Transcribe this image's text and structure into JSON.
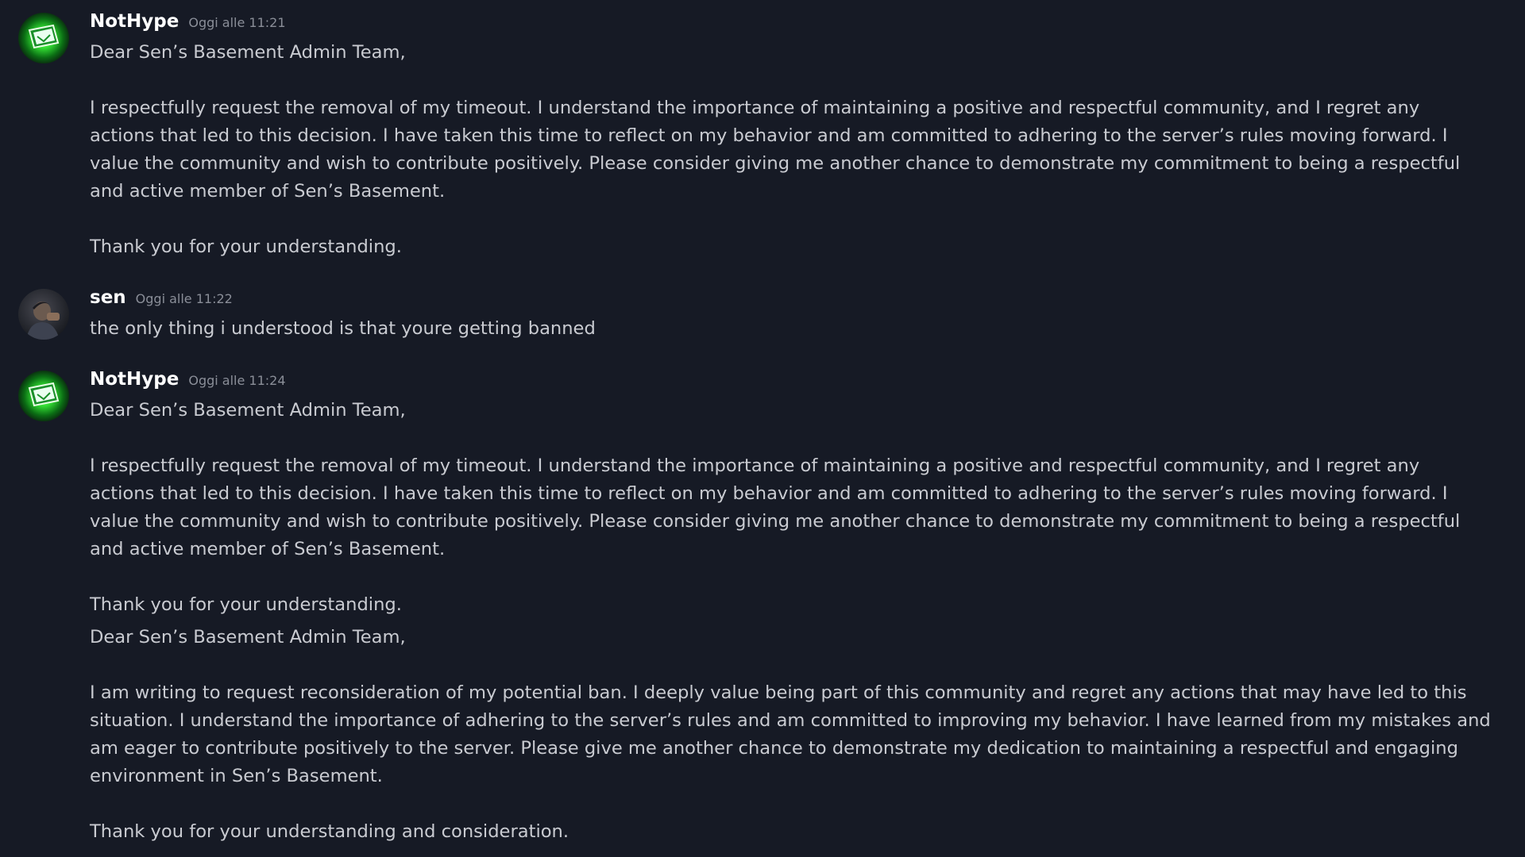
{
  "colors": {
    "background": "#161a25",
    "text": "#c9cbd1",
    "username": "#ffffff",
    "timestamp": "#8a8e98",
    "avatar_green": "#33cc33"
  },
  "messages": [
    {
      "author": "NotHype",
      "timestamp": "Oggi alle 11:21",
      "avatar_icon": "green-glowing-computer-avatar",
      "lines": [
        "Dear Sen’s Basement Admin Team,",
        "I respectfully request the removal of my timeout. I understand the importance of maintaining a positive and respectful community, and I regret any",
        "actions that led to this decision. I have taken this time to reflect on my behavior and am committed to adhering to the server’s rules moving forward. I",
        "value the community and wish to contribute positively. Please consider giving me another chance to demonstrate my commitment to being a respectful",
        "and active member of Sen’s Basement.",
        "Thank you for your understanding."
      ]
    },
    {
      "author": "sen",
      "timestamp": "Oggi alle 11:22",
      "avatar_icon": "person-photo-avatar",
      "lines": [
        "the only thing i understood is that youre getting banned"
      ]
    },
    {
      "author": "NotHype",
      "timestamp": "Oggi alle 11:24",
      "avatar_icon": "green-glowing-computer-avatar",
      "lines": [
        "Dear Sen’s Basement Admin Team,",
        "I respectfully request the removal of my timeout. I understand the importance of maintaining a positive and respectful community, and I regret any",
        "actions that led to this decision. I have taken this time to reflect on my behavior and am committed to adhering to the server’s rules moving forward. I",
        "value the community and wish to contribute positively. Please consider giving me another chance to demonstrate my commitment to being a respectful",
        "and active member of Sen’s Basement.",
        "Thank you for your understanding.",
        "Dear Sen’s Basement Admin Team,",
        "I am writing to request reconsideration of my potential ban. I deeply value being part of this community and regret any actions that may have led to this",
        "situation. I understand the importance of adhering to the server’s rules and am committed to improving my behavior. I have learned from my mistakes and",
        "am eager to contribute positively to the server. Please give me another chance to demonstrate my dedication to maintaining a respectful and engaging",
        "environment in Sen’s Basement.",
        "Thank you for your understanding and consideration."
      ]
    }
  ]
}
